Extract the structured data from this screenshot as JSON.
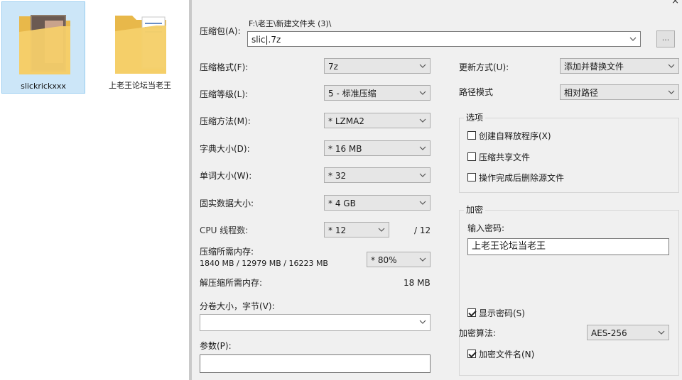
{
  "desktop": {
    "icons": [
      {
        "label": "slickrickxxx",
        "selected": true
      },
      {
        "label": "上老王论坛当老王",
        "selected": false
      }
    ]
  },
  "dialog": {
    "title_close": "×",
    "archive": {
      "label": "压缩包(A):",
      "path": "F:\\老王\\新建文件夹 (3)\\",
      "value": "slic|.7z",
      "browse_label": "..."
    },
    "left": {
      "format": {
        "label": "压缩格式(F):",
        "value": "7z"
      },
      "level": {
        "label": "压缩等级(L):",
        "value": "5 - 标准压缩"
      },
      "method": {
        "label": "压缩方法(M):",
        "value": "* LZMA2"
      },
      "dict": {
        "label": "字典大小(D):",
        "value": "* 16 MB"
      },
      "word": {
        "label": "单词大小(W):",
        "value": "* 32"
      },
      "solid": {
        "label": "固实数据大小:",
        "value": "* 4 GB"
      },
      "cpu": {
        "label": "CPU 线程数:",
        "value": "* 12",
        "total": "/ 12"
      },
      "memory": {
        "label": "压缩所需内存:",
        "detail": "1840 MB / 12979 MB / 16223 MB",
        "value": "* 80%"
      },
      "decompress_memory": {
        "label": "解压缩所需内存:",
        "value": "18 MB"
      },
      "split": {
        "label": "分卷大小，字节(V):",
        "value": ""
      },
      "params": {
        "label": "参数(P):",
        "value": ""
      }
    },
    "right": {
      "update_mode": {
        "label": "更新方式(U):",
        "value": "添加并替换文件"
      },
      "path_mode": {
        "label": "路径模式",
        "value": "相对路径"
      },
      "options": {
        "title": "选项",
        "items": [
          {
            "label": "创建自释放程序(X)",
            "checked": false
          },
          {
            "label": "压缩共享文件",
            "checked": false
          },
          {
            "label": "操作完成后删除源文件",
            "checked": false
          }
        ]
      },
      "encryption": {
        "title": "加密",
        "password_label": "输入密码:",
        "password_value": "上老王论坛当老王",
        "show_password": {
          "label": "显示密码(S)",
          "checked": true
        },
        "method_label": "加密算法:",
        "method_value": "AES-256",
        "encrypt_names": {
          "label": "加密文件名(N)",
          "checked": true
        }
      }
    }
  }
}
